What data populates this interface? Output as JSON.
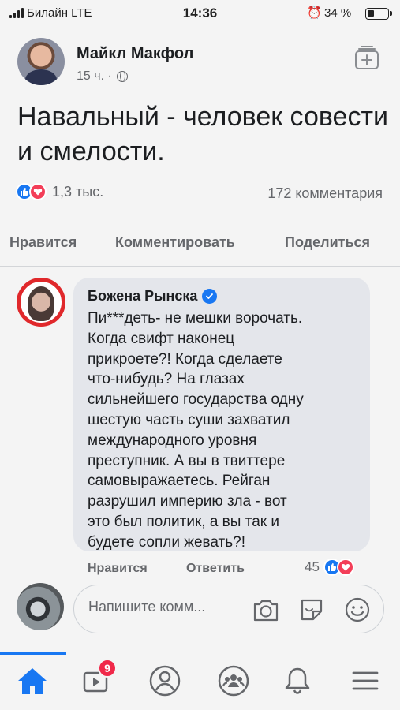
{
  "status_bar": {
    "carrier": "Билайн  LTE",
    "time": "14:36",
    "battery": "34 %",
    "battery_level": 0.34
  },
  "post": {
    "author": "Майкл Макфол",
    "meta": "15 ч. ·",
    "text": "Навальный - человек совести и смелости.",
    "reaction_count": "1,3 тыс.",
    "comment_count": "172 комментария"
  },
  "actions": {
    "like": "Нравится",
    "comment": "Комментировать",
    "share": "Поделиться"
  },
  "comment": {
    "author": "Божена Рынска",
    "text": "Пи***деть- не мешки ворочать.\nКогда свифт наконец\nприкроете?! Когда сделаете\nчто-нибудь? На глазах\nсильнейшего государства одну\nшестую часть суши захватил\nмеждународного уровня\nпреступник. А вы в твиттере\nсамовыражаетесь. Рейган\nразрушил империю зла - вот\nэто был политик, а вы так и\nбудете сопли жевать?!",
    "like_label": "Нравится",
    "reply_label": "Ответить",
    "reaction_count": "45"
  },
  "composer": {
    "placeholder": "Напишите комм..."
  },
  "nav": {
    "video_badge": "9"
  },
  "colors": {
    "accent": "#1877f2",
    "love": "#f33e58",
    "badge": "#f02849"
  }
}
